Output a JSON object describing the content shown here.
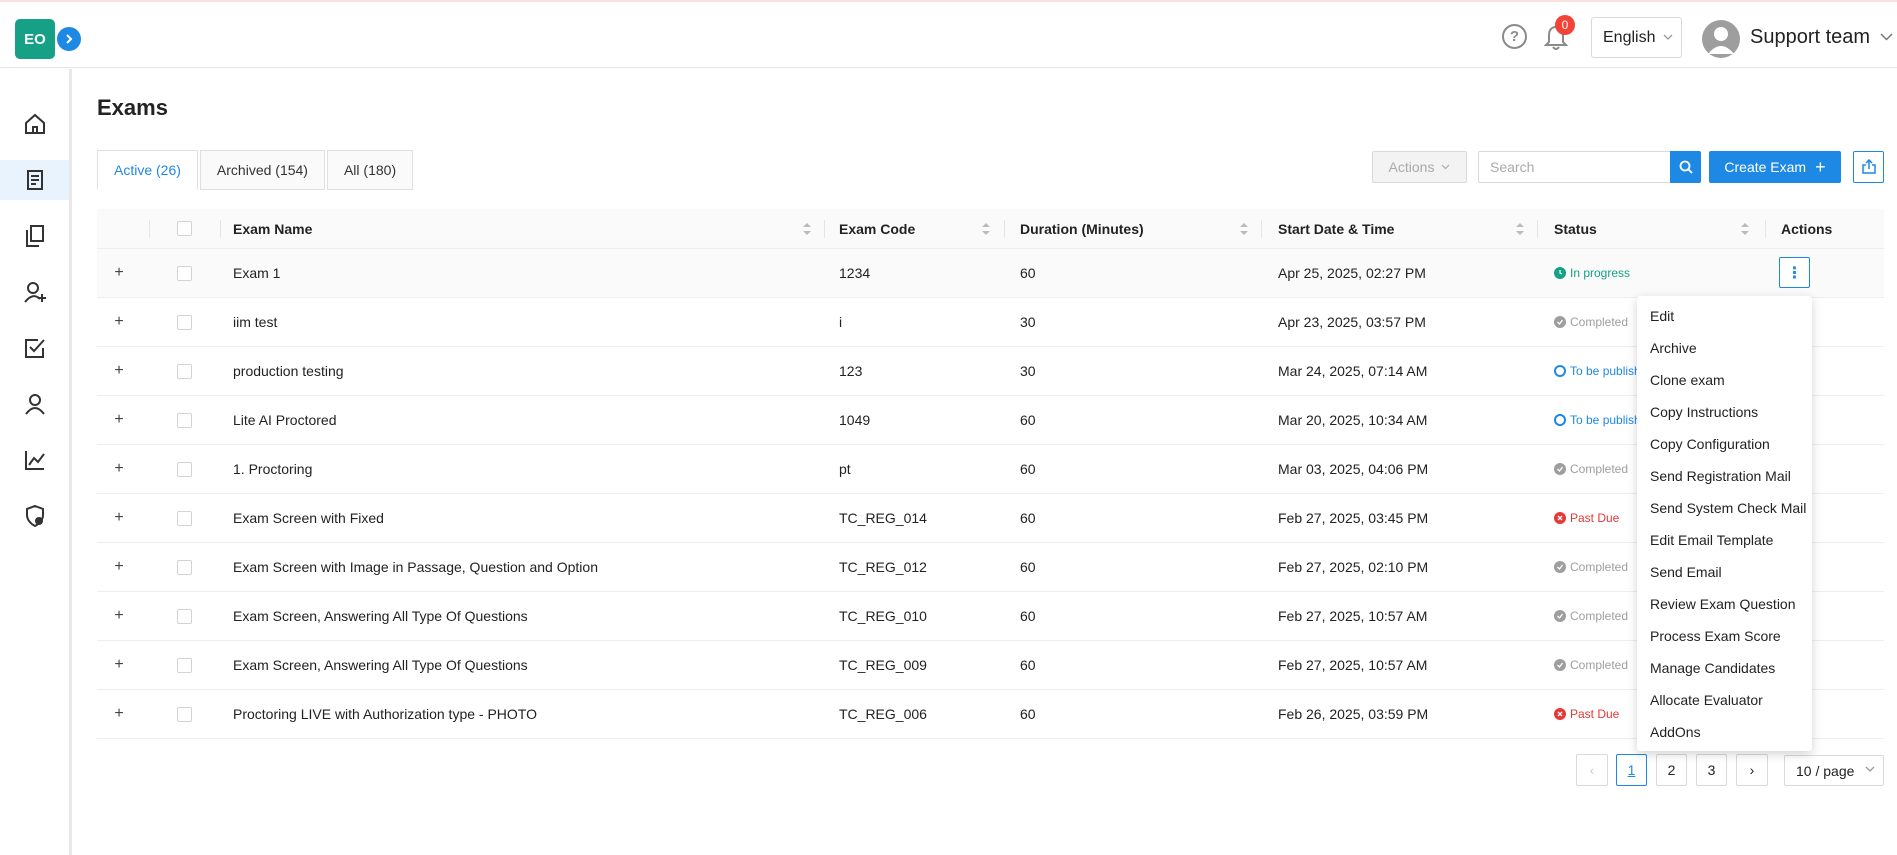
{
  "header": {
    "logo_text": "EO",
    "help_glyph": "?",
    "notification_count": "0",
    "language": "English",
    "user_name": "Support team"
  },
  "sidebar": {
    "items": [
      {
        "icon": "home-icon"
      },
      {
        "icon": "exams-icon",
        "active": true
      },
      {
        "icon": "documents-icon"
      },
      {
        "icon": "add-user-icon"
      },
      {
        "icon": "checklist-icon"
      },
      {
        "icon": "user-icon"
      },
      {
        "icon": "chart-icon"
      },
      {
        "icon": "shield-settings-icon"
      }
    ]
  },
  "page": {
    "title": "Exams",
    "tabs": [
      {
        "label": "Active (26)",
        "active": true
      },
      {
        "label": "Archived (154)"
      },
      {
        "label": "All (180)"
      }
    ]
  },
  "toolbar": {
    "actions_label": "Actions",
    "search_placeholder": "Search",
    "create_label": "Create Exam",
    "create_plus": "+"
  },
  "table": {
    "columns": [
      "Exam Name",
      "Exam Code",
      "Duration (Minutes)",
      "Start Date & Time",
      "Status",
      "Actions"
    ],
    "rows": [
      {
        "name": "Exam 1",
        "code": "1234",
        "duration": "60",
        "start": "Apr 25, 2025, 02:27 PM",
        "status": "In progress",
        "status_type": "progress"
      },
      {
        "name": "iim test",
        "code": "i",
        "duration": "30",
        "start": "Apr 23, 2025, 03:57 PM",
        "status": "Completed",
        "status_type": "completed"
      },
      {
        "name": "production testing",
        "code": "123",
        "duration": "30",
        "start": "Mar 24, 2025, 07:14 AM",
        "status": "To be publish",
        "status_type": "publish"
      },
      {
        "name": "Lite AI Proctored",
        "code": "1049",
        "duration": "60",
        "start": "Mar 20, 2025, 10:34 AM",
        "status": "To be publish",
        "status_type": "publish"
      },
      {
        "name": "1. Proctoring",
        "code": "pt",
        "duration": "60",
        "start": "Mar 03, 2025, 04:06 PM",
        "status": "Completed",
        "status_type": "completed"
      },
      {
        "name": "Exam Screen with Fixed",
        "code": "TC_REG_014",
        "duration": "60",
        "start": "Feb 27, 2025, 03:45 PM",
        "status": "Past Due",
        "status_type": "pastdue"
      },
      {
        "name": "Exam Screen with Image in Passage, Question and Option",
        "code": "TC_REG_012",
        "duration": "60",
        "start": "Feb 27, 2025, 02:10 PM",
        "status": "Completed",
        "status_type": "completed"
      },
      {
        "name": "Exam Screen, Answering All Type Of Questions",
        "code": "TC_REG_010",
        "duration": "60",
        "start": "Feb 27, 2025, 10:57 AM",
        "status": "Completed",
        "status_type": "completed"
      },
      {
        "name": "Exam Screen, Answering All Type Of Questions",
        "code": "TC_REG_009",
        "duration": "60",
        "start": "Feb 27, 2025, 10:57 AM",
        "status": "Completed",
        "status_type": "completed"
      },
      {
        "name": "Proctoring LIVE with Authorization type - PHOTO",
        "code": "TC_REG_006",
        "duration": "60",
        "start": "Feb 26, 2025, 03:59 PM",
        "status": "Past Due",
        "status_type": "pastdue"
      }
    ]
  },
  "action_menu": {
    "items": [
      "Edit",
      "Archive",
      "Clone exam",
      "Copy Instructions",
      "Copy Configuration",
      "Send Registration Mail",
      "Send System Check Mail",
      "Edit Email Template",
      "Send Email",
      "Review Exam Question",
      "Process Exam Score",
      "Manage Candidates",
      "Allocate Evaluator",
      "AddOns"
    ]
  },
  "pagination": {
    "prev": "‹",
    "pages": [
      "1",
      "2",
      "3"
    ],
    "current": "1",
    "next": "›",
    "page_size": "10 / page"
  },
  "colors": {
    "primary": "#1e88e5",
    "logo": "#16a085",
    "progress": "#16a085",
    "completed": "#9e9e9e",
    "publish": "#1e88e5",
    "pastdue": "#e53935",
    "badge": "#f44336"
  }
}
